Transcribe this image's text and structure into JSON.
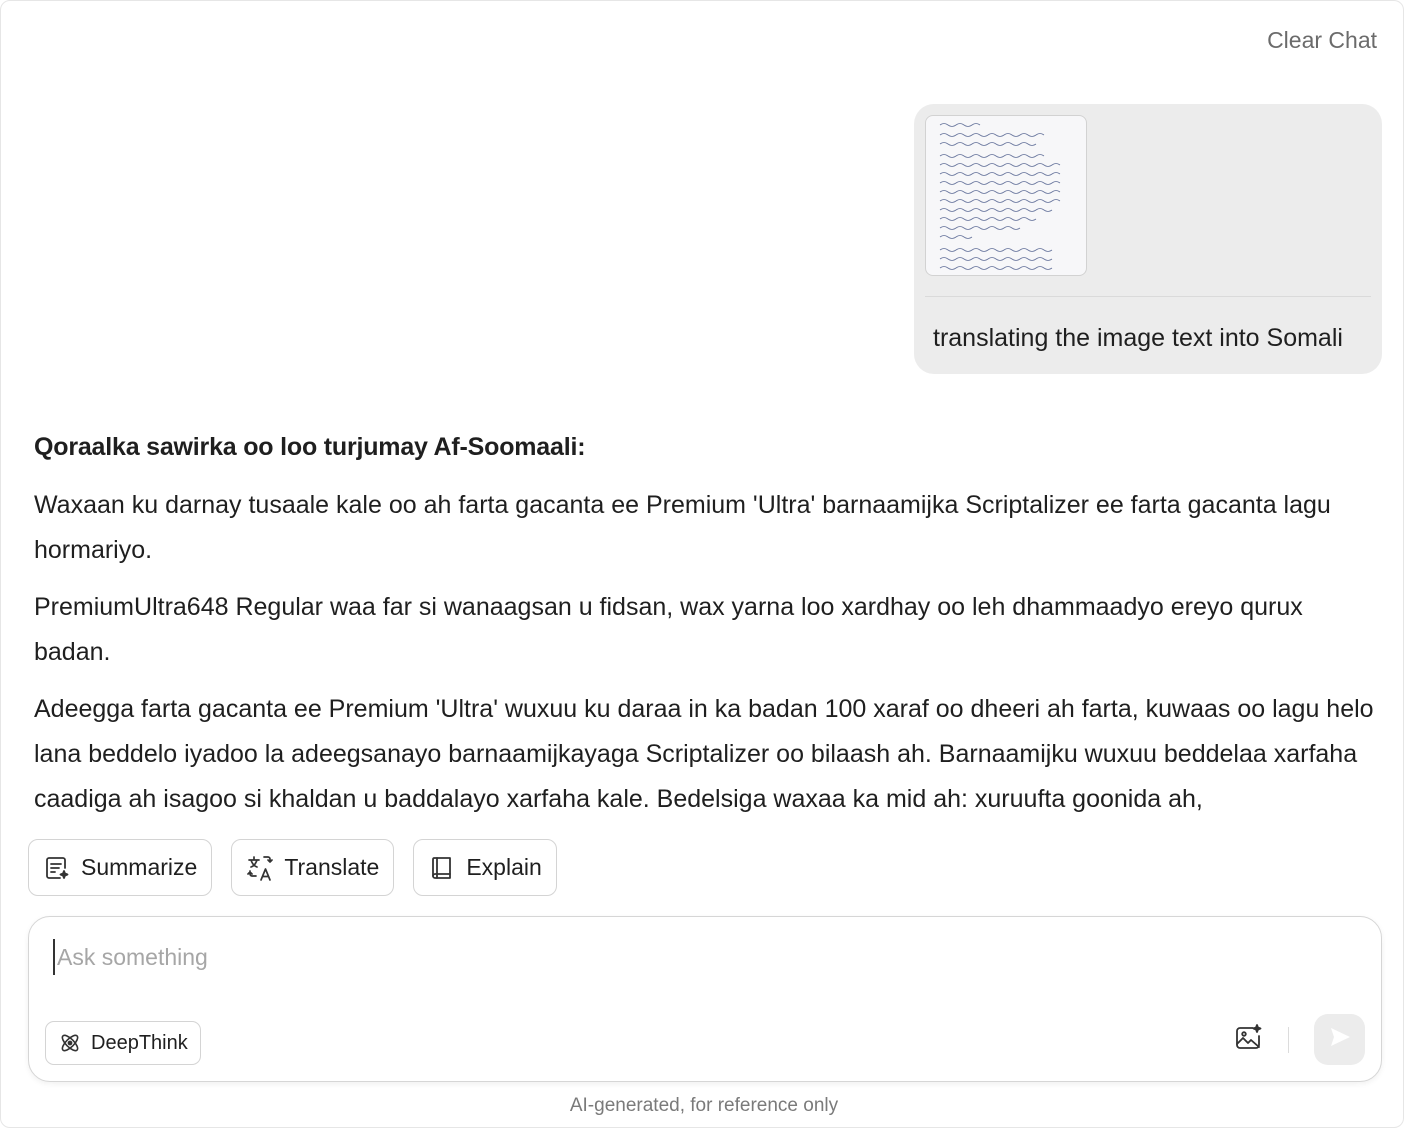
{
  "header": {
    "clear_chat_label": "Clear Chat"
  },
  "user_message": {
    "text": "translating the image text into Somali",
    "attachment_icon": "handwritten-document-thumbnail"
  },
  "answer": {
    "heading": "Qoraalka sawirka oo loo turjumay Af-Soomaali:",
    "paragraphs": [
      "Waxaan ku darnay tusaale kale oo ah farta gacanta ee Premium 'Ultra' barnaamijka Scriptalizer ee farta gacanta lagu hormariyo.",
      "PremiumUltra648 Regular waa far si wanaagsan u fidsan, wax yarna loo xardhay oo leh dhammaadyo ereyo qurux badan.",
      "Adeegga farta gacanta ee Premium 'Ultra' wuxuu ku daraa in ka badan 100 xaraf oo dheeri ah farta, kuwaas oo lagu helo lana beddelo iyadoo la adeegsanayo barnaamijkayaga Scriptalizer oo bilaash ah. Barnaamijku wuxuu beddelaa xarfaha caadiga ah isagoo si khaldan u baddalayo xarfaha kale. Bedelsiga waxaa ka mid ah: xuruufta goonida ah,"
    ]
  },
  "actions": [
    {
      "label": "Summarize",
      "icon": "summarize-icon"
    },
    {
      "label": "Translate",
      "icon": "translate-icon"
    },
    {
      "label": "Explain",
      "icon": "book-icon"
    }
  ],
  "composer": {
    "placeholder": "Ask something",
    "value": "",
    "deepthink_label": "DeepThink",
    "deepthink_icon": "atom-icon",
    "image_button_icon": "image-sparkle-icon",
    "send_icon": "send-icon"
  },
  "footer": {
    "note": "AI-generated, for reference only"
  },
  "colors": {
    "bubble_bg": "#ececec",
    "muted_text": "#6b6b6b",
    "border": "#d4d4d4",
    "send_bg": "#ececec"
  }
}
